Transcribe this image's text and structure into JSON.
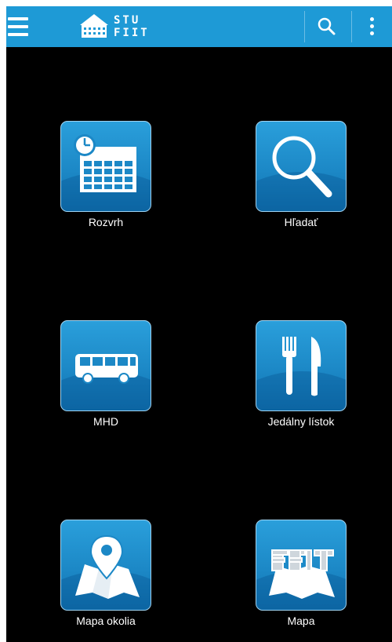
{
  "app": {
    "logo_line1": "STU",
    "logo_line2": "FIIT"
  },
  "colors": {
    "appbar": "#1e9ad6",
    "background": "#000000",
    "tile_gradient_top": "#2a9fdb",
    "tile_gradient_bottom": "#1172b0"
  },
  "toolbar": {
    "menu_icon": "hamburger-menu-icon",
    "search_icon": "search-icon",
    "overflow_icon": "more-vert-icon"
  },
  "tiles": [
    {
      "label": "Rozvrh",
      "icon": "calendar-clock-icon"
    },
    {
      "label": "Hľadať",
      "icon": "magnifier-icon"
    },
    {
      "label": "MHD",
      "icon": "bus-icon"
    },
    {
      "label": "Jedálny lístok",
      "icon": "fork-knife-icon"
    },
    {
      "label": "Mapa okolia",
      "icon": "map-pin-icon"
    },
    {
      "label": "Mapa",
      "icon": "fiit-map-icon"
    }
  ]
}
